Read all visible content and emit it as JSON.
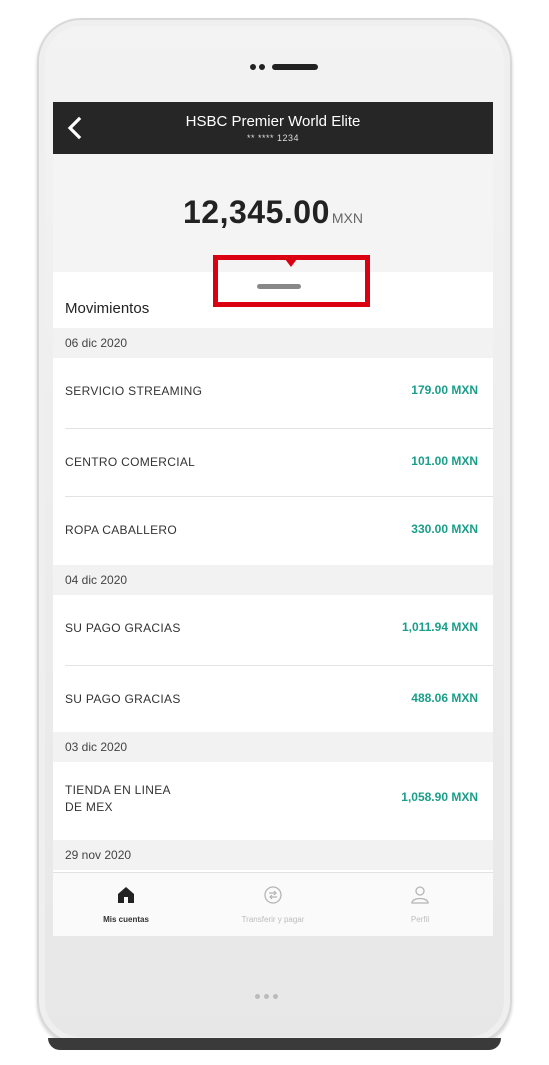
{
  "header": {
    "title": "HSBC Premier World Elite",
    "account_masked": "** **** 1234"
  },
  "balance": {
    "amount": "12,345.00",
    "currency": "MXN"
  },
  "movements": {
    "title": "Movimientos",
    "groups": [
      {
        "date": "06 dic 2020",
        "items": [
          {
            "description": "SERVICIO STREAMING",
            "amount": "179.00 MXN"
          },
          {
            "description": "CENTRO COMERCIAL",
            "amount": "101.00 MXN"
          },
          {
            "description": "ROPA CABALLERO",
            "amount": "330.00 MXN"
          }
        ]
      },
      {
        "date": "04 dic 2020",
        "items": [
          {
            "description": "SU PAGO GRACIAS",
            "amount": "1,011.94 MXN"
          },
          {
            "description": "SU PAGO GRACIAS",
            "amount": "488.06 MXN"
          }
        ]
      },
      {
        "date": "03 dic 2020",
        "items": [
          {
            "description_line1": "TIENDA EN LINEA",
            "description_line2": "DE MEX",
            "amount": "1,058.90 MXN"
          }
        ]
      },
      {
        "date": "29 nov 2020",
        "items": []
      }
    ]
  },
  "tabbar": {
    "tabs": [
      {
        "label": "Mis cuentas",
        "icon": "home-icon",
        "active": true
      },
      {
        "label": "Transferir y pagar",
        "icon": "transfer-icon",
        "active": false
      },
      {
        "label": "Perfil",
        "icon": "profile-icon",
        "active": false
      }
    ]
  },
  "colors": {
    "header_bg": "#262626",
    "amount_green": "#1a9e8a",
    "highlight_red": "#db0011"
  }
}
